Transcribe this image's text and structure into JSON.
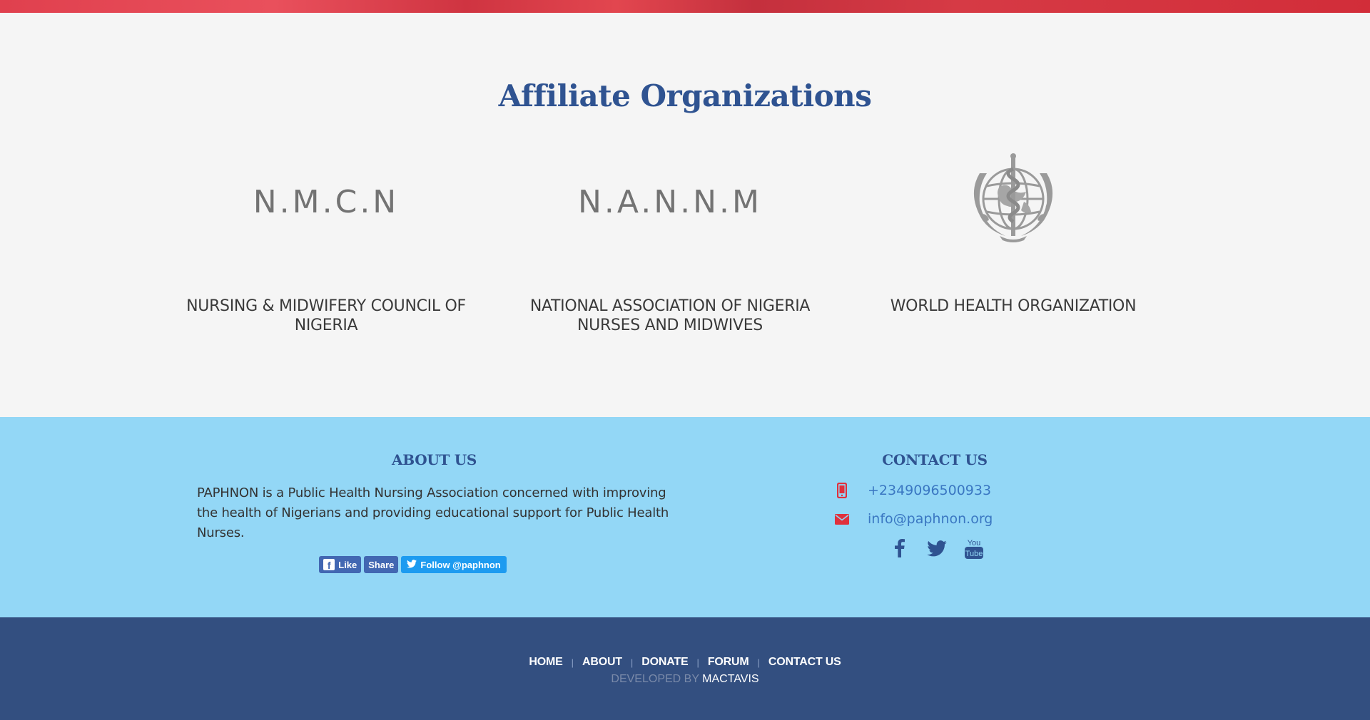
{
  "affiliates": {
    "title_bold": "Affiliate",
    "title_rest": "Organizations",
    "orgs": [
      {
        "logo_text": "N.M.C.N",
        "name": "NURSING & MIDWIFERY COUNCIL OF NIGERIA"
      },
      {
        "logo_text": "N.A.N.N.M",
        "name": "NATIONAL ASSOCIATION OF NIGERIA NURSES AND MIDWIVES"
      },
      {
        "logo_icon": "who-emblem-icon",
        "name": "WORLD HEALTH ORGANIZATION"
      }
    ]
  },
  "about": {
    "title": "ABOUT US",
    "text": "PAPHNON is a Public Health Nursing Association concerned with improving the health of Nigerians and providing educational support for Public Health Nurses.",
    "buttons": {
      "like": "Like",
      "share": "Share",
      "follow": "Follow @paphnon"
    }
  },
  "contact": {
    "title": "CONTACT US",
    "phone": "+2349096500933",
    "email": "info@paphnon.org",
    "social_icons": [
      "facebook-icon",
      "twitter-icon",
      "youtube-icon"
    ],
    "youtube_label": "You Tube"
  },
  "footer": {
    "nav": [
      "HOME",
      "ABOUT",
      "DONATE",
      "FORUM",
      "CONTACT US"
    ],
    "developed_by": "DEVELOPED BY",
    "developer": "MACTAVIS"
  },
  "colors": {
    "brand_blue": "#2f5391",
    "info_bg": "#93d7f6",
    "footer_bg": "#334f80",
    "accent_red": "#e0303c",
    "link_blue": "#3a77c2"
  }
}
